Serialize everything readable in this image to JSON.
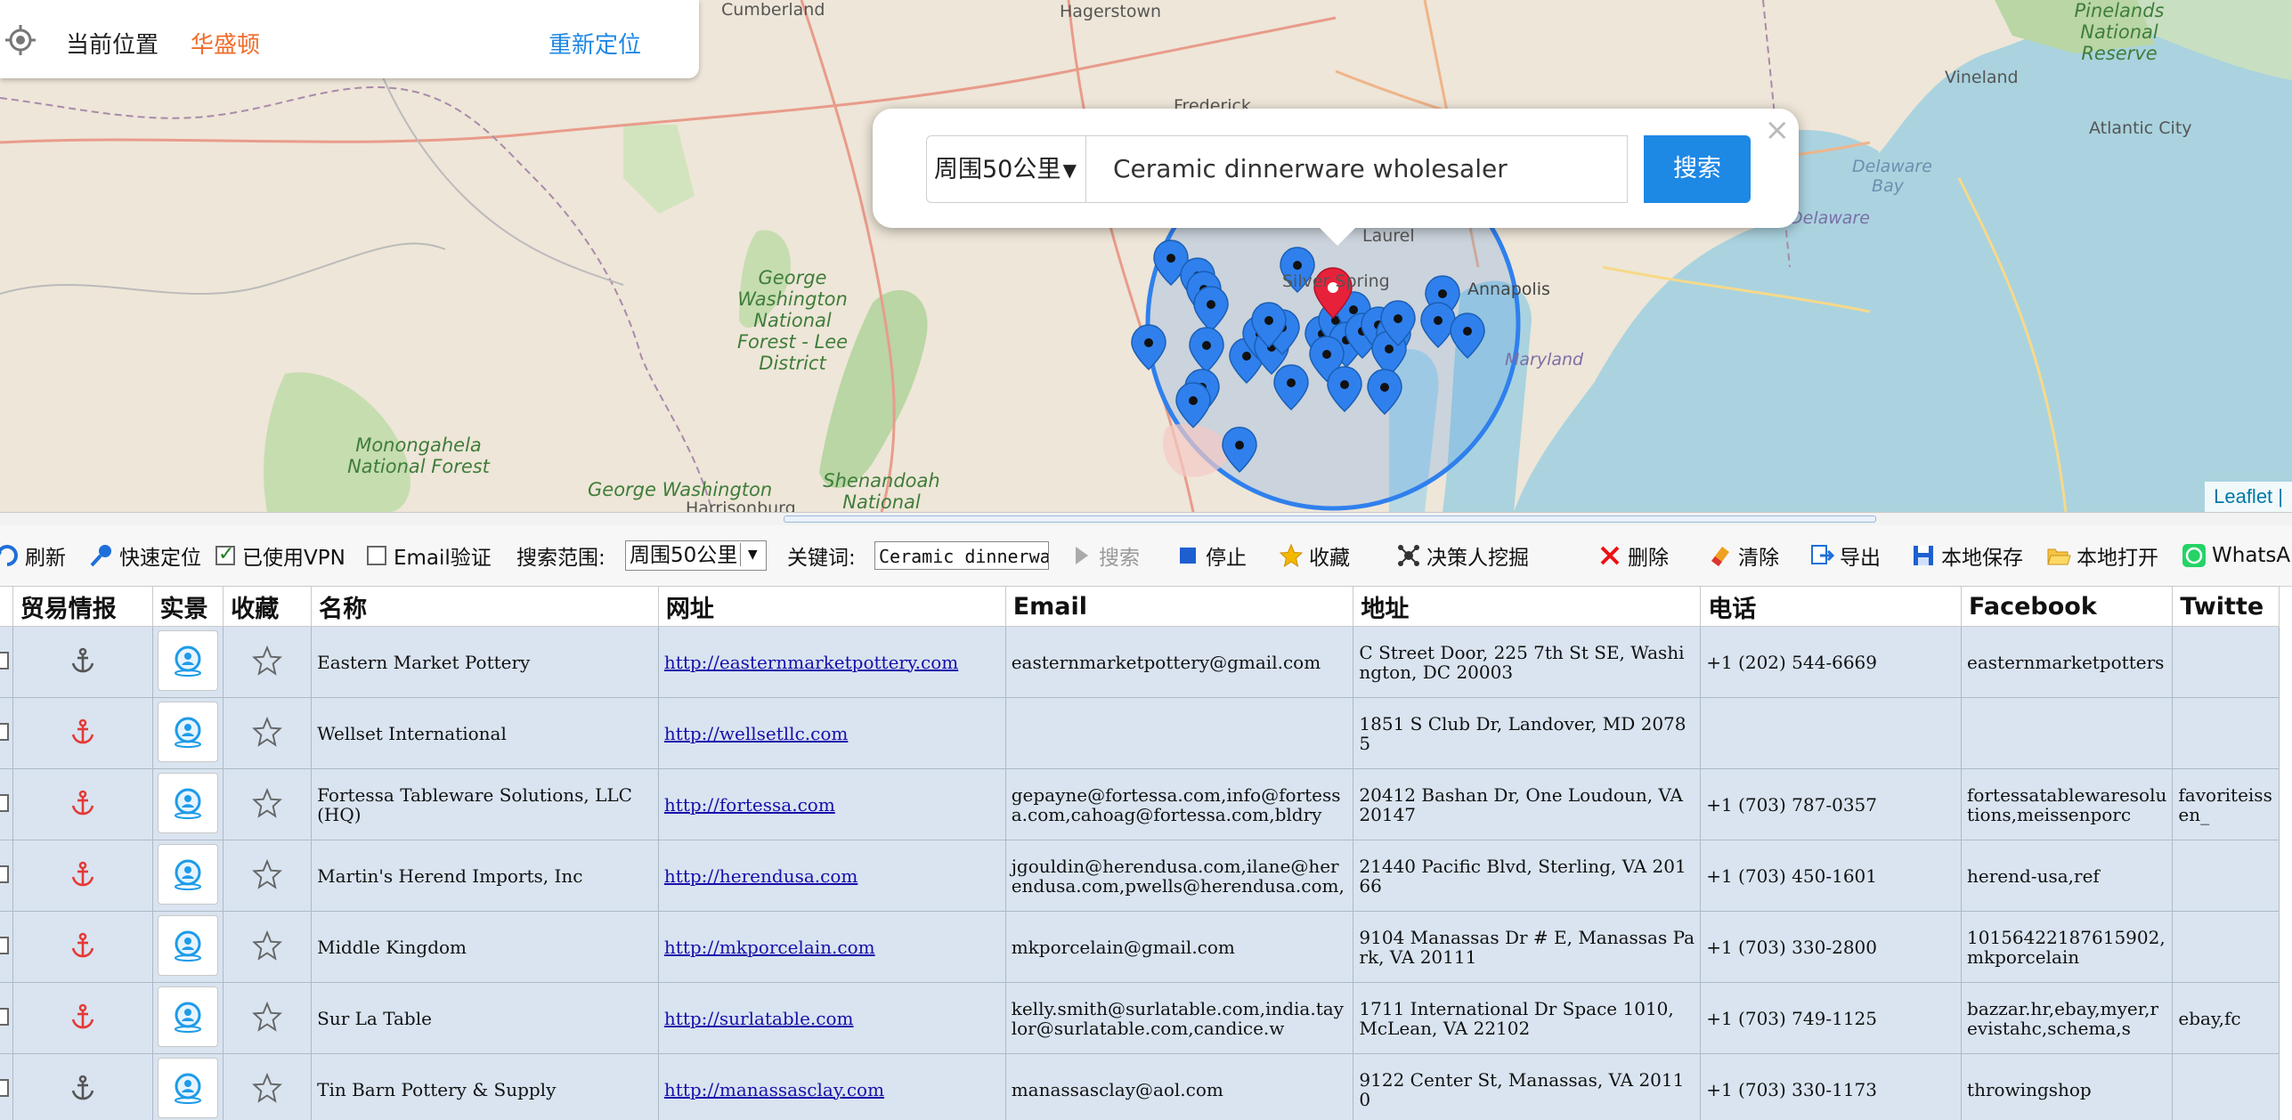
{
  "location_bar": {
    "label": "当前位置",
    "city": "华盛顿",
    "relocate": "重新定位"
  },
  "map": {
    "labels": {
      "cumberland": "Cumberland",
      "hagerstown": "Hagerstown",
      "frederick": "Frederick",
      "laurel": "Laurel",
      "silver_spring": "Silver Spring",
      "annapolis": "Annapolis",
      "maryland": "Maryland",
      "vineland": "Vineland",
      "atlantic_city": "Atlantic City",
      "delaware": "Delaware",
      "delaware_bay": "Delaware Bay",
      "pinelands": "Pinelands National Reserve",
      "gw_forest": "George Washington National Forest - Lee District",
      "monongahela": "Monongahela National Forest",
      "george_w_bottom": "George Washington",
      "harrisonburg": "Harrisonburg",
      "shenandoah": "Shenandoah National"
    },
    "attribution": "Leaflet |"
  },
  "search_popup": {
    "range_value": "周围50公里",
    "keyword_value": "Ceramic dinnerware wholesaler",
    "search_label": "搜索",
    "close_label": "×"
  },
  "toolbar": {
    "refresh": "刷新",
    "quick_locate": "快速定位",
    "use_vpn": "已使用VPN",
    "use_vpn_checked": true,
    "email_verify": "Email验证",
    "email_verify_checked": false,
    "search_range_label": "搜索范围:",
    "search_range_value": "周围50公里",
    "keyword_label": "关键词:",
    "keyword_value": "Ceramic dinnerwa",
    "search": "搜索",
    "stop": "停止",
    "favorite": "收藏",
    "decision_maker": "决策人挖掘",
    "delete": "删除",
    "clear": "清除",
    "export": "导出",
    "save_local": "本地保存",
    "open_local": "本地打开",
    "whatsapp": "WhatsAP"
  },
  "table": {
    "headers": [
      "贸易情报",
      "实景",
      "收藏",
      "名称",
      "网址",
      "Email",
      "地址",
      "电话",
      "Facebook",
      "Twitte"
    ],
    "rows": [
      {
        "anchor_color": "#555555",
        "name": "Eastern Market Pottery",
        "url": "http://easternmarketpottery.com",
        "email": "easternmarketpottery@gmail.com",
        "address": "C Street Door, 225 7th St SE, Washington, DC 20003",
        "phone": "+1 (202) 544-6669",
        "facebook": "easternmarketpotters",
        "twitter": ""
      },
      {
        "anchor_color": "#e53935",
        "name": "Wellset International",
        "url": "http://wellsetllc.com",
        "email": "",
        "address": "1851 S Club Dr, Landover, MD 20785",
        "phone": "",
        "facebook": "",
        "twitter": ""
      },
      {
        "anchor_color": "#e53935",
        "name": "Fortessa Tableware Solutions, LLC (HQ)",
        "url": "http://fortessa.com",
        "email": "gepayne@fortessa.com,info@fortessa.com,cahoag@fortessa.com,bldry",
        "address": "20412 Bashan Dr, One Loudoun, VA 20147",
        "phone": "+1 (703) 787-0357",
        "facebook": "fortessatablewaresolutions,meissenporc",
        "twitter": "favoriteissen_"
      },
      {
        "anchor_color": "#e53935",
        "name": "Martin's Herend Imports, Inc",
        "url": "http://herendusa.com",
        "email": "jgouldin@herendusa.com,ilane@herendusa.com,pwells@herendusa.com,",
        "address": "21440 Pacific Blvd, Sterling, VA 20166",
        "phone": "+1 (703) 450-1601",
        "facebook": "herend-usa,ref",
        "twitter": ""
      },
      {
        "anchor_color": "#e53935",
        "name": "Middle Kingdom",
        "url": "http://mkporcelain.com",
        "email": "mkporcelain@gmail.com",
        "address": "9104 Manassas Dr # E, Manassas Park, VA 20111",
        "phone": "+1 (703) 330-2800",
        "facebook": "10156422187615902,mkporcelain",
        "twitter": ""
      },
      {
        "anchor_color": "#e53935",
        "name": "Sur La Table",
        "url": "http://surlatable.com",
        "email": "kelly.smith@surlatable.com,india.taylor@surlatable.com,candice.w",
        "address": "1711 International Dr Space 1010, McLean, VA 22102",
        "phone": "+1 (703) 749-1125",
        "facebook": "bazzar.hr,ebay,myer,revistahc,schema,s",
        "twitter": "ebay,fc"
      },
      {
        "anchor_color": "#555555",
        "name": "Tin Barn Pottery & Supply",
        "url": "http://manassasclay.com",
        "email": "manassasclay@aol.com",
        "address": "9122 Center St, Manassas, VA 20110",
        "phone": "+1 (703) 330-1173",
        "facebook": "throwingshop",
        "twitter": ""
      }
    ]
  },
  "colors": {
    "accent_blue": "#1e88e5",
    "city_orange": "#ef6c2c",
    "row_bg": "#d9e4f0",
    "marker_blue": "#2f80ed",
    "marker_red": "#e8213b"
  }
}
